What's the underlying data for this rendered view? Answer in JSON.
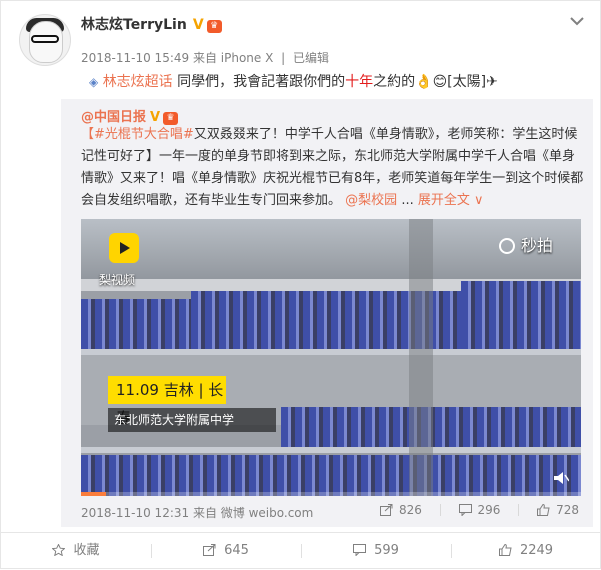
{
  "post": {
    "author": "林志炫TerryLin",
    "verified_badge": "V",
    "timestamp": "2018-11-10 15:49",
    "source": "来自 iPhone X",
    "edited": "已编辑",
    "status": {
      "link_text": "林志炫超话",
      "text_before": " 同學們，我會記著跟你們的",
      "accent": "十年",
      "text_after": "之約的👌😊[太陽]✈"
    }
  },
  "repost": {
    "author": "@中国日报",
    "verified_badge": "V",
    "hashtag": "#光棍节大合唱#",
    "body": "又双叒叕来了！中学千人合唱《单身情歌》，老师笑称：学生这时候记性可好了】一年一度的单身节即将到来之际，东北师范大学附属中学千人合唱《单身情歌》又来了！唱《单身情歌》庆祝光棍节已有8年，老师笑道每年学生一到这个时候都会自发组织唱歌，还有毕业生专门回来参加。",
    "bracket_open": "【",
    "mention": "@梨校园",
    "expand_label": "展开全文",
    "video": {
      "brand_label": "梨视频",
      "watermark": "秒拍",
      "date_location": "11.09 吉林 | 长春",
      "school": "东北师范大学附属中学",
      "progress": 0.05
    },
    "timestamp": "2018-11-10 12:31",
    "source": "来自 微博 weibo.com",
    "reposts": "826",
    "comments": "296",
    "likes": "728"
  },
  "actions": {
    "favorite": "收藏",
    "repost": "645",
    "comment": "599",
    "like": "2249"
  },
  "colors": {
    "accent_orange": "#eb7350",
    "red": "#e31c1c",
    "verified_gold": "#f5a300"
  }
}
